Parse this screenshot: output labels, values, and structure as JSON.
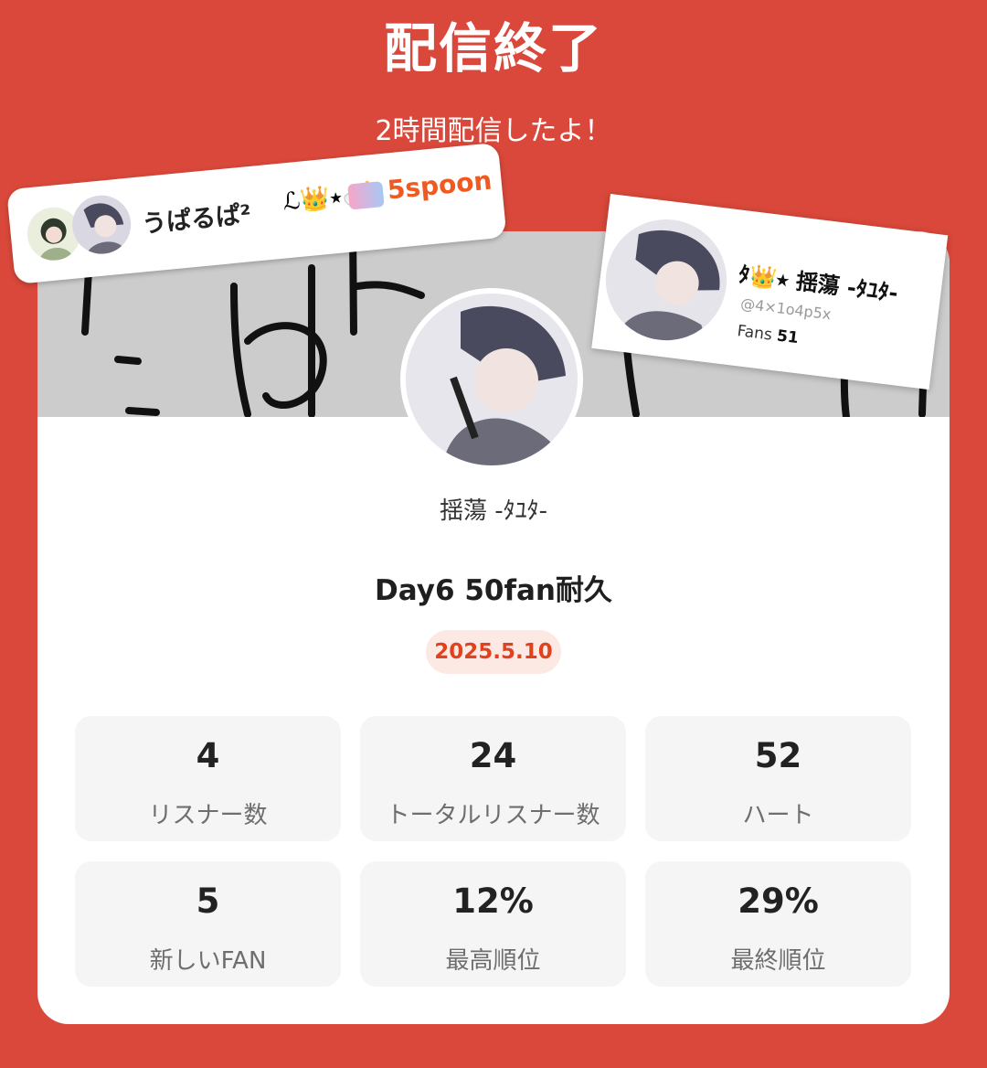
{
  "header": {
    "title": "配信終了",
    "subtitle": "2時間配信したよ！"
  },
  "profile": {
    "username": "揺蕩 -ﾀﾕﾀ-",
    "stream_title": "Day6 50fan耐久",
    "date": "2025.5.10"
  },
  "stats": [
    {
      "value": "4",
      "label": "リスナー数"
    },
    {
      "value": "24",
      "label": "トータルリスナー数"
    },
    {
      "value": "52",
      "label": "ハート"
    },
    {
      "value": "5",
      "label": "新しいFAN"
    },
    {
      "value": "12%",
      "label": "最高順位"
    },
    {
      "value": "29%",
      "label": "最終順位"
    }
  ],
  "sticker_left": {
    "name": "うぱるぱ²",
    "emoji": "ℒ👑⭑🍼",
    "spoon": "5spoon"
  },
  "sticker_right": {
    "name": "ﾀ👑⭑ 揺蕩 -ﾀﾕﾀ-",
    "handle": "@4×1o4p5x",
    "fans_label": "Fans",
    "fans_value": "51"
  },
  "colors": {
    "background": "#d9483a",
    "accent": "#e0421e",
    "badge_bg": "#fde9e4",
    "stat_bg": "#f5f5f5"
  }
}
